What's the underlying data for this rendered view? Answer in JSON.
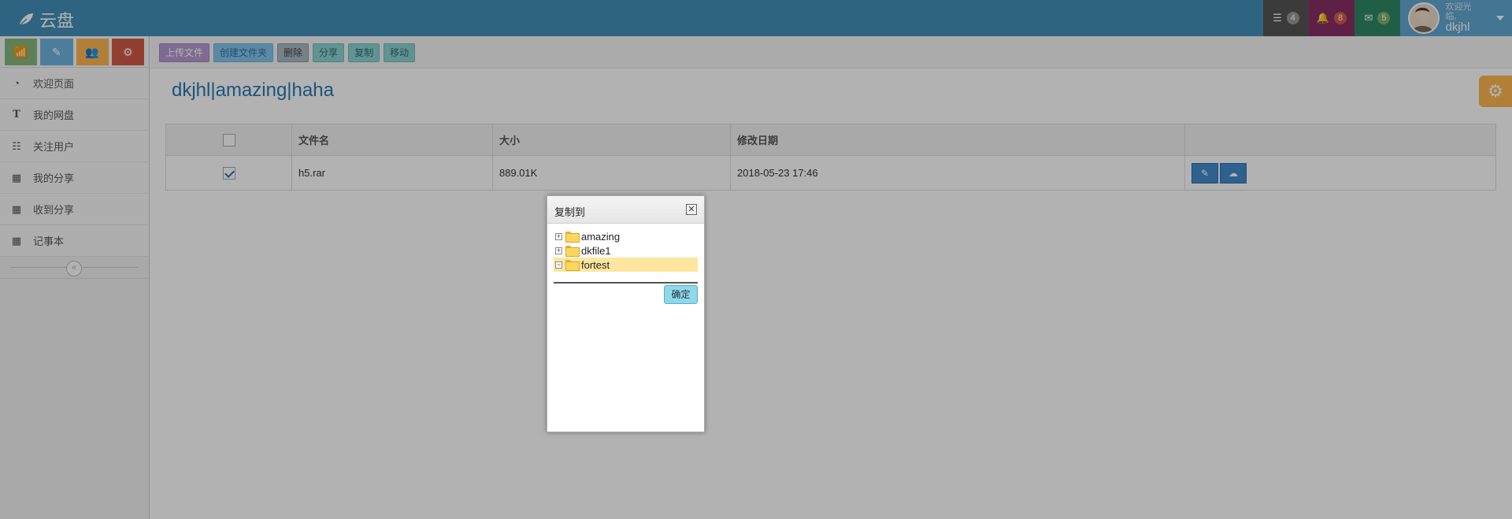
{
  "app": {
    "brand": "云盘"
  },
  "navbar": {
    "tasks_count": "4",
    "notifications_count": "8",
    "messages_count": "5",
    "user": {
      "welcome": "欢迎光临,",
      "name": "dkjhl"
    }
  },
  "sidebar": {
    "items": [
      {
        "label": "欢迎页面",
        "icon": "dashboard-icon"
      },
      {
        "label": "我的网盘",
        "icon": "text-icon"
      },
      {
        "label": "关注用户",
        "icon": "list-icon"
      },
      {
        "label": "我的分享",
        "icon": "calendar-icon"
      },
      {
        "label": "收到分享",
        "icon": "calendar-icon"
      },
      {
        "label": "记事本",
        "icon": "calendar-icon"
      }
    ],
    "collapse_glyph": "«"
  },
  "toolbar": {
    "upload": "上传文件",
    "create_folder": "创建文件夹",
    "delete": "删除",
    "share": "分享",
    "copy": "复制",
    "move": "移动"
  },
  "page": {
    "title": "dkjhl|amazing|haha"
  },
  "table": {
    "headers": {
      "name": "文件名",
      "size": "大小",
      "date": "修改日期"
    },
    "rows": [
      {
        "name": "h5.rar",
        "size": "889.01K",
        "date": "2018-05-23 17:46",
        "checked": true
      }
    ]
  },
  "dialog": {
    "title": "复制到",
    "close": "✕",
    "tree": [
      {
        "label": "amazing",
        "toggle": "+"
      },
      {
        "label": "dkfile1",
        "toggle": "+"
      },
      {
        "label": "fortest",
        "toggle": "−",
        "selected": true
      }
    ],
    "ok": "确定"
  },
  "colors": {
    "navbar": "#438eb9",
    "title": "#2679b5",
    "selected_node": "#ffe6a0"
  }
}
